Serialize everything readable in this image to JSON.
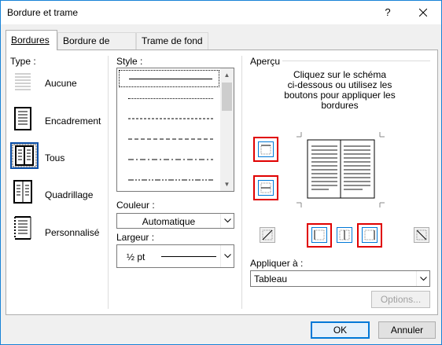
{
  "window": {
    "title": "Bordure et trame",
    "help_label": "?"
  },
  "tabs": [
    {
      "label": "Bordures",
      "active": true
    },
    {
      "label": "Bordure de page",
      "active": false
    },
    {
      "label": "Trame de fond",
      "active": false
    }
  ],
  "setting": {
    "label": "Type :",
    "options": [
      {
        "label": "Aucune",
        "icon": "none-border-icon",
        "selected": false
      },
      {
        "label": "Encadrement",
        "icon": "box-border-icon",
        "selected": false
      },
      {
        "label": "Tous",
        "icon": "all-borders-icon",
        "selected": true
      },
      {
        "label": "Quadrillage",
        "icon": "grid-border-icon",
        "selected": false
      },
      {
        "label": "Personnalisé",
        "icon": "custom-border-icon",
        "selected": false
      }
    ]
  },
  "style": {
    "label": "Style :",
    "line_styles": [
      "solid",
      "dotted-fine",
      "dashed-small",
      "dashed-medium",
      "dash-dot",
      "dash-dot-dot"
    ],
    "selected": "solid"
  },
  "color": {
    "label": "Couleur :",
    "value": "Automatique"
  },
  "width": {
    "label": "Largeur :",
    "value": "½ pt"
  },
  "preview": {
    "label": "Aperçu",
    "instructions": "Cliquez sur le schéma\nci-dessous ou utilisez les\nboutons pour appliquer les\nbordures"
  },
  "apply_to": {
    "label": "Appliquer à :",
    "value": "Tableau"
  },
  "buttons": {
    "options": "Options...",
    "ok": "OK",
    "cancel": "Annuler"
  },
  "colors": {
    "highlight": "#e00000",
    "accent": "#0078d7",
    "selected_border": "#0b4fa8"
  }
}
